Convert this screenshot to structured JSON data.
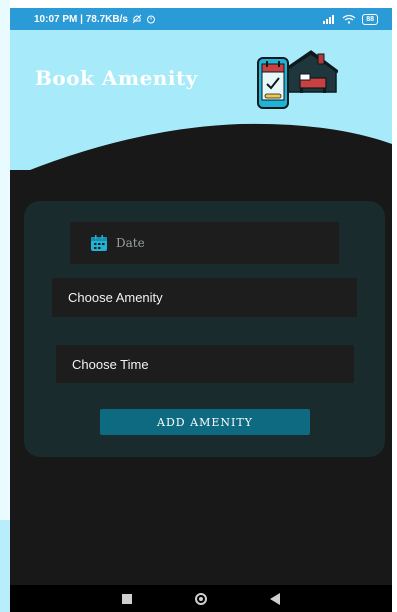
{
  "status_bar": {
    "time_and_speed": "10:07 PM | 78.7KB/s",
    "battery": "88"
  },
  "header": {
    "title": "Book Amenity"
  },
  "form": {
    "date_label": "Date",
    "amenity_label": "Choose Amenity",
    "time_label": "Choose Time",
    "submit_label": "ADD AMENITY"
  },
  "colors": {
    "header_bg": "#a7ebfa",
    "status_bar": "#2a9bd6",
    "card_bg": "#1a2b2e",
    "button_bg": "#0e6a80",
    "accent_icon": "#21b3d6"
  },
  "icons": [
    "calendar-icon",
    "phone-calendar-illustration",
    "house-bed-illustration",
    "wifi-icon",
    "signal-icon",
    "alarm-icon",
    "mute-icon"
  ]
}
